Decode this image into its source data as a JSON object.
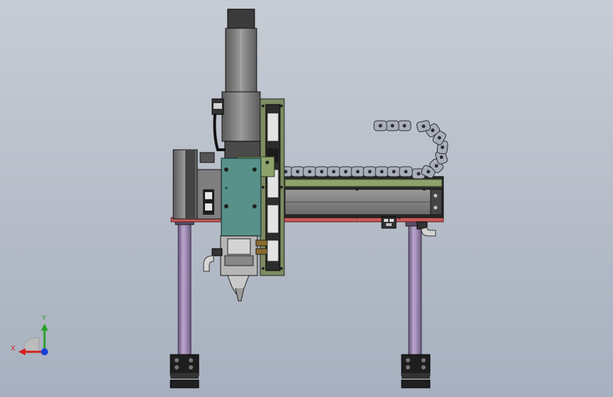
{
  "viewport": {
    "background_top": "#c7ccd4",
    "background_bottom": "#a7b0bf"
  },
  "colors": {
    "column": "#9a84b0",
    "base_block": "#1e1e1e",
    "carriage": "#57918a",
    "side_plate": "#7d8c62",
    "rail_face": "#7e7e7e",
    "rail_frame": "#2a2a2a",
    "motor_body": "#858585",
    "red_rail_edge": "#c85a5a",
    "chain_link": "#a9aebb",
    "green_top_plate": "#8ea36c"
  },
  "triad": {
    "x_label": "X",
    "y_label": "Y",
    "x_color": "#d42020",
    "y_color": "#2aa12a",
    "z_color": "#1c3fd6"
  },
  "icons": {
    "triad": "axis-triad-icon"
  }
}
